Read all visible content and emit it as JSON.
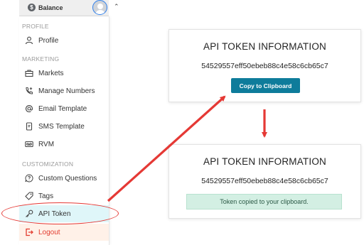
{
  "topbar": {
    "balance_label": "Balance",
    "coin_symbol": "$"
  },
  "sidebar": {
    "sections": [
      {
        "label": "PROFILE"
      },
      {
        "label": "MARKETING"
      },
      {
        "label": "CUSTOMIZATION"
      }
    ],
    "items": [
      {
        "label": "Profile",
        "icon": "user-icon"
      },
      {
        "label": "Markets",
        "icon": "briefcase-icon"
      },
      {
        "label": "Manage Numbers",
        "icon": "phone-plus-icon"
      },
      {
        "label": "Email Template",
        "icon": "at-icon"
      },
      {
        "label": "SMS Template",
        "icon": "message-icon"
      },
      {
        "label": "RVM",
        "icon": "voicemail-icon"
      },
      {
        "label": "Custom Questions",
        "icon": "question-icon"
      },
      {
        "label": "Tags",
        "icon": "tag-icon"
      },
      {
        "label": "API Token",
        "icon": "key-icon",
        "active": true
      },
      {
        "label": "Logout",
        "icon": "logout-icon"
      }
    ]
  },
  "card_before": {
    "title": "API TOKEN INFORMATION",
    "token": "54529557eff50ebeb88c4e58c6cb65c7",
    "button_label": "Copy to Clipboard"
  },
  "card_after": {
    "title": "API TOKEN INFORMATION",
    "token": "54529557eff50ebeb88c4e58c6cb65c7",
    "message": "Token copied to your clipboard."
  },
  "colors": {
    "annotation": "#e53935",
    "button": "#0e7c9b",
    "active_item": "#dff6f9",
    "logout": "#e23b2e",
    "success_bg": "#d3efe3"
  }
}
